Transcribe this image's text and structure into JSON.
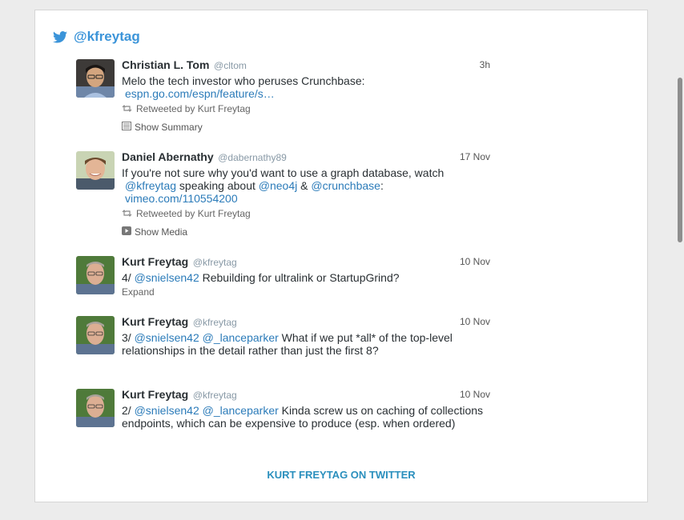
{
  "widget": {
    "handle": "@kfreytag",
    "footer_link": "KURT FREYTAG ON TWITTER"
  },
  "tweets": [
    {
      "name": "Christian L. Tom",
      "screen_name": "@cltom",
      "time": "3h",
      "text": "Melo the tech investor who peruses Crunchbase:",
      "link": "espn.go.com/espn/feature/s…",
      "retweeted_by": "Retweeted by Kurt Freytag",
      "action": "Show Summary"
    },
    {
      "name": "Daniel Abernathy",
      "screen_name": "@dabernathy89",
      "time": "17 Nov",
      "text_part1": "If you're not sure why you'd want to use a graph database, watch",
      "mention1": "@kfreytag",
      "text_part2": "speaking about",
      "mention2": "@neo4j",
      "text_part3": "&",
      "mention3": "@crunchbase",
      "text_part4": ":",
      "link": "vimeo.com/110554200",
      "retweeted_by": "Retweeted by Kurt Freytag",
      "action": "Show Media"
    },
    {
      "name": "Kurt Freytag",
      "screen_name": "@kfreytag",
      "time": "10 Nov",
      "prefix": "4/",
      "mention1": "@snielsen42",
      "text": "Rebuilding for ultralink or StartupGrind?",
      "action": "Expand"
    },
    {
      "name": "Kurt Freytag",
      "screen_name": "@kfreytag",
      "time": "10 Nov",
      "prefix": "3/",
      "mention1": "@snielsen42",
      "mention2": "@_lanceparker",
      "text": "What if we put *all* of the top-level relationships in the detail rather than just the first 8?"
    },
    {
      "name": "Kurt Freytag",
      "screen_name": "@kfreytag",
      "time": "10 Nov",
      "prefix": "2/",
      "mention1": "@snielsen42",
      "mention2": "@_lanceparker",
      "text": "Kinda screw us on caching of collections endpoints, which can be expensive to produce (esp. when ordered)"
    }
  ]
}
